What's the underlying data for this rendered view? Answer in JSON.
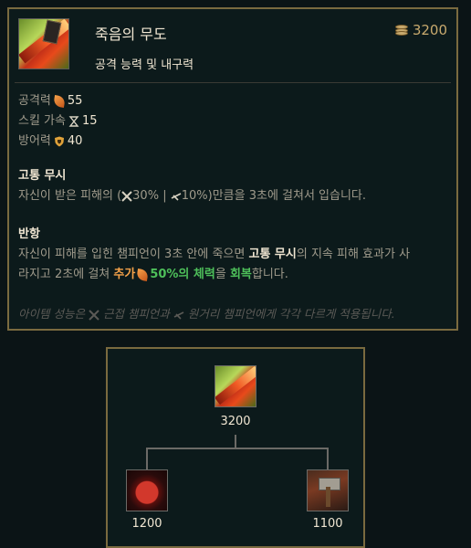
{
  "item": {
    "name": "죽음의 무도",
    "subtitle": "공격 능력 및 내구력",
    "price": "3200",
    "icon": "death-dance-icon"
  },
  "stats": [
    {
      "label": "공격력",
      "icon": "attack-damage-icon",
      "value": "55"
    },
    {
      "label": "스킬 가속",
      "icon": "ability-haste-icon",
      "value": "15"
    },
    {
      "label": "방어력",
      "icon": "armor-icon",
      "value": "40"
    }
  ],
  "passive1": {
    "title": "고통 무시",
    "text_a": "자신이 받은 피해의 (",
    "melee": "30%",
    "sep": " | ",
    "ranged": "10%",
    "text_b": ")만큼을 3초에 걸쳐서 입습니다."
  },
  "passive2": {
    "title": "반항",
    "t1": "자신이 피해를 입힌 챔피언이 3초 안에 죽으면 ",
    "t2": "고통 무시",
    "t3": "의 지속 피해 효과가 사",
    "t4": "라지고 2초에 걸쳐 ",
    "t5": "추가",
    "t6": "50%의 체력",
    "t7": "을 ",
    "t8": "회복",
    "t9": "합니다."
  },
  "note": {
    "a": "아이템 성능은",
    "b": "근접 챔피언과",
    "c": "원거리 챔피언에게 각각 다르게 적용됩니다."
  },
  "tree": {
    "root": {
      "icon": "death-dance-icon",
      "price": "3200"
    },
    "children": [
      {
        "icon": "executioners-calling-icon",
        "price": "1200"
      },
      {
        "icon": "caulfields-warhammer-icon",
        "price": "1100"
      }
    ]
  },
  "colors": {
    "gold": "#c8aa6e",
    "border": "#7a6a3f",
    "heal": "#4ec05a",
    "ad": "#f5a24a"
  }
}
